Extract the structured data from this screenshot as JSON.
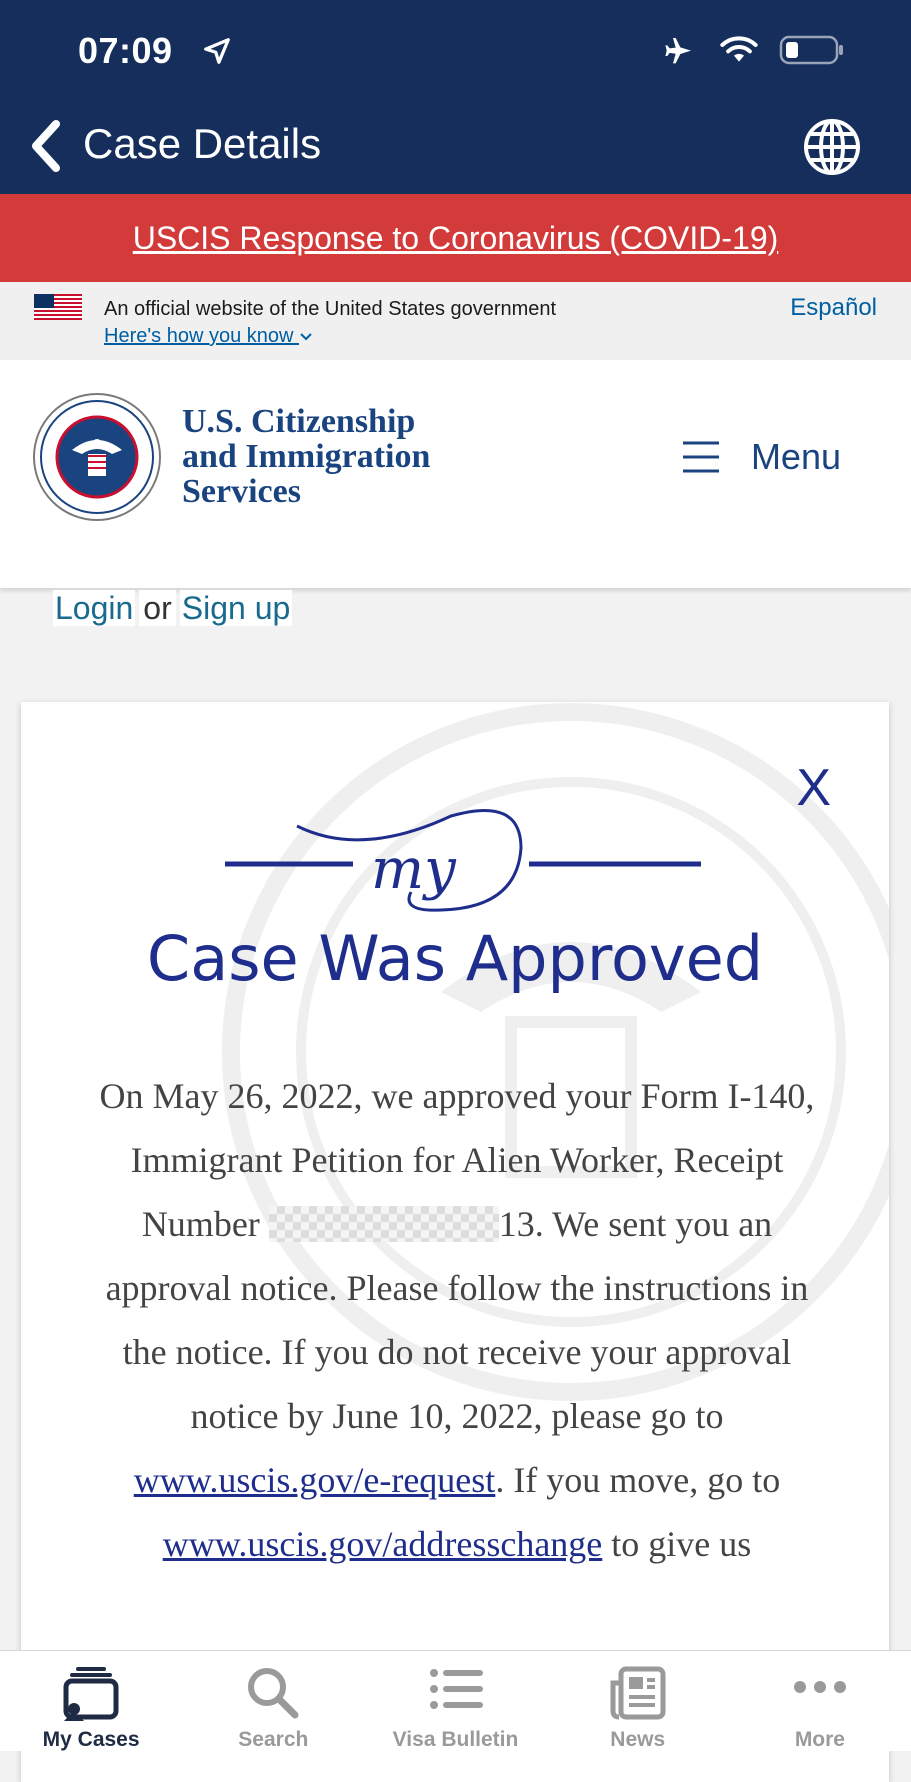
{
  "status_bar": {
    "time": "07:09"
  },
  "nav": {
    "title": "Case Details"
  },
  "covid_banner": {
    "text": "USCIS Response to Coronavirus (COVID-19)"
  },
  "official_banner": {
    "text": "An official website of the United States government",
    "how_link": "Here's how you know",
    "language_link": "Español"
  },
  "site_header": {
    "agency_line1": "U.S. Citizenship",
    "agency_line2": "and Immigration",
    "agency_line3": "Services",
    "menu_label": "Menu"
  },
  "auth": {
    "login": "Login",
    "or": "or",
    "signup": "Sign up"
  },
  "case_card": {
    "close_label": "X",
    "status_title": "Case Was Approved",
    "body_part1": "On May 26, 2022, we approved your Form I-140, Immigrant Petition for Alien Worker, Receipt Number ",
    "receipt_suffix": "13.",
    "body_part2": " We sent you an approval notice. Please follow the instructions in the notice. If you do not receive your approval notice by June 10, 2022, please go to ",
    "link1": "www.uscis.gov/e-request",
    "body_part3": ". If you move, go to ",
    "link2": "www.uscis.gov/addresschange",
    "body_part4": " to give us"
  },
  "tab_bar": {
    "tabs": [
      {
        "label": "My Cases",
        "icon": "cases-icon"
      },
      {
        "label": "Search",
        "icon": "search-icon"
      },
      {
        "label": "Visa Bulletin",
        "icon": "list-icon"
      },
      {
        "label": "News",
        "icon": "news-icon"
      },
      {
        "label": "More",
        "icon": "more-icon"
      }
    ]
  },
  "colors": {
    "header": "#152e5c",
    "banner": "#d33a3a",
    "brand": "#1f2e8c"
  }
}
